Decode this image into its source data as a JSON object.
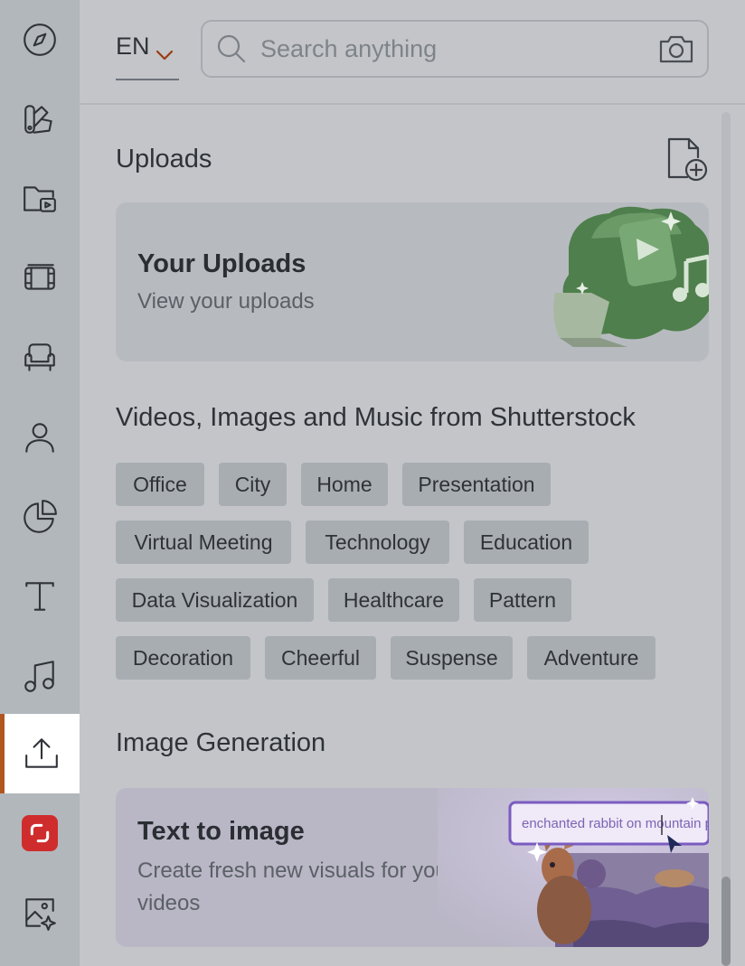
{
  "language": {
    "code": "EN"
  },
  "search": {
    "placeholder": "Search anything"
  },
  "rail": {
    "items": [
      {
        "name": "explore",
        "icon": "compass-icon"
      },
      {
        "name": "brand-kit",
        "icon": "swatches-icon"
      },
      {
        "name": "media-folder",
        "icon": "folder-video-icon"
      },
      {
        "name": "videos",
        "icon": "film-icon"
      },
      {
        "name": "scenes",
        "icon": "armchair-icon"
      },
      {
        "name": "avatars",
        "icon": "person-icon"
      },
      {
        "name": "charts",
        "icon": "pie-chart-icon"
      },
      {
        "name": "text",
        "icon": "text-icon"
      },
      {
        "name": "music",
        "icon": "music-note-icon"
      },
      {
        "name": "uploads",
        "icon": "upload-icon",
        "active": true
      },
      {
        "name": "shutterstock",
        "icon": "shutterstock-icon"
      },
      {
        "name": "image-generation",
        "icon": "sparkle-image-icon"
      }
    ],
    "active_color": "#b2561f"
  },
  "uploads": {
    "title": "Uploads",
    "card_title": "Your Uploads",
    "card_subtitle": "View your uploads"
  },
  "shutterstock": {
    "title": "Videos, Images and Music from Shutterstock",
    "tags": [
      "Office",
      "City",
      "Home",
      "Presentation",
      "Virtual Meeting",
      "Technology",
      "Education",
      "Data Visualization",
      "Healthcare",
      "Pattern",
      "Decoration",
      "Cheerful",
      "Suspense",
      "Adventure"
    ]
  },
  "image_generation": {
    "title": "Image Generation",
    "card_title": "Text to image",
    "card_subtitle_line1": "Create fresh new visuals for your",
    "card_subtitle_line2": "videos",
    "prompt_example": "enchanted rabbit on mountain pla"
  }
}
